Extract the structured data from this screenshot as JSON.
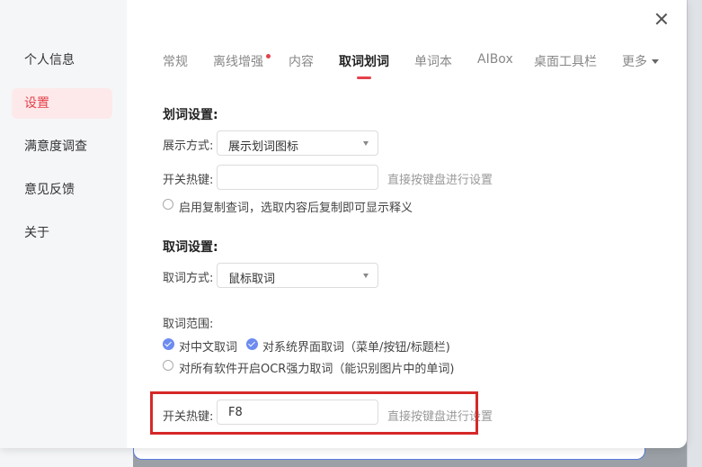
{
  "sidebar": {
    "items": [
      {
        "label": "个人信息"
      },
      {
        "label": "设置"
      },
      {
        "label": "满意度调查"
      },
      {
        "label": "意见反馈"
      },
      {
        "label": "关于"
      }
    ],
    "active_index": 1
  },
  "tabs": {
    "items": [
      {
        "label": "常规"
      },
      {
        "label": "离线增强"
      },
      {
        "label": "内容"
      },
      {
        "label": "取词划词"
      },
      {
        "label": "单词本"
      },
      {
        "label": "AIBox"
      },
      {
        "label": "桌面工具栏"
      },
      {
        "label": "更多"
      }
    ],
    "active": "取词划词"
  },
  "highlight_section": {
    "title": "划词设置:",
    "display_mode_label": "展示方式:",
    "display_mode_value": "展示划词图标",
    "hotkey_label": "开关热键:",
    "hotkey_value": "",
    "hotkey_hint": "直接按键盘进行设置",
    "copy_lookup_label": "启用复制查词，选取内容后复制即可显示释义",
    "copy_lookup_checked": false
  },
  "lookup_section": {
    "title": "取词设置:",
    "mode_label": "取词方式:",
    "mode_value": "鼠标取词",
    "scope_label": "取词范围:",
    "scope_options": [
      {
        "label": "对中文取词",
        "checked": true
      },
      {
        "label": "对系统界面取词（菜单/按钮/标题栏)",
        "checked": true
      },
      {
        "label": "对所有软件开启OCR强力取词（能识别图片中的单词)",
        "checked": false
      }
    ],
    "hotkey_label": "开关热键:",
    "hotkey_value": "F8",
    "hotkey_hint": "直接按键盘进行设置"
  },
  "colors": {
    "accent": "#e5414b",
    "checkbox": "#6d8cef",
    "annotation_box": "#d62828"
  }
}
